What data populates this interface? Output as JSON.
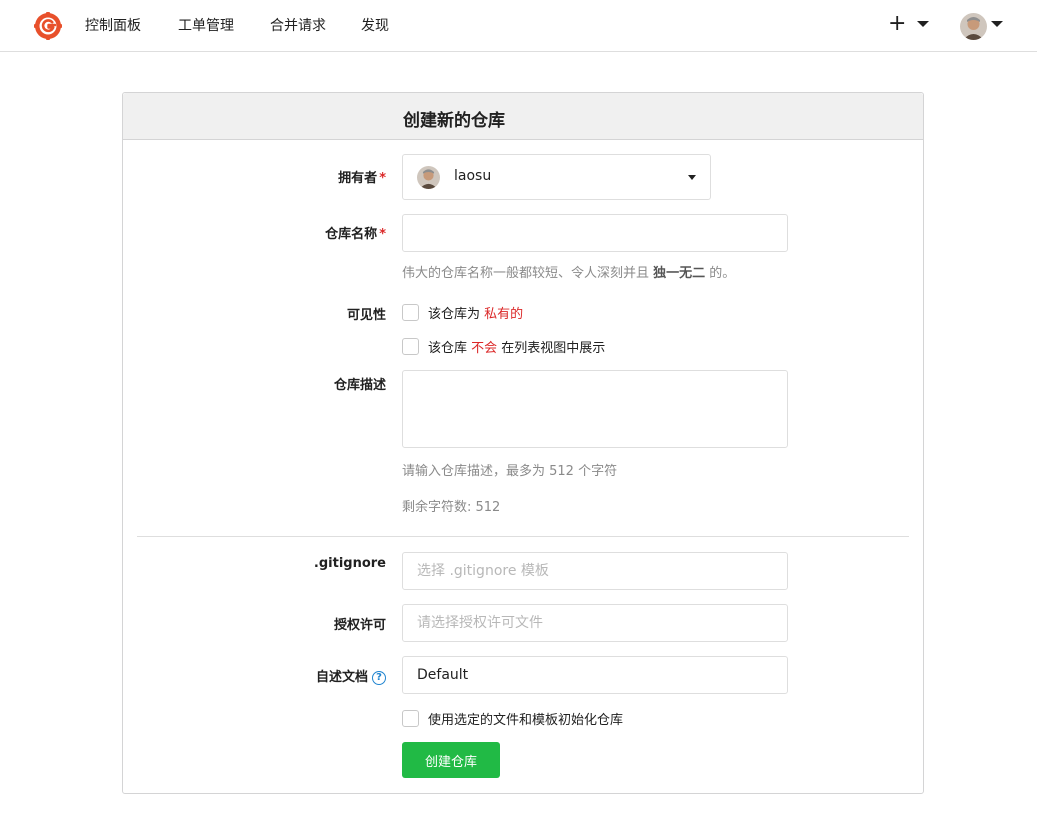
{
  "nav": {
    "items": [
      {
        "label": "控制面板"
      },
      {
        "label": "工单管理"
      },
      {
        "label": "合并请求"
      },
      {
        "label": "发现"
      }
    ],
    "plus": "+"
  },
  "form": {
    "title": "创建新的仓库",
    "owner": {
      "label": "拥有者",
      "required": "*",
      "value": "laosu"
    },
    "repo_name": {
      "label": "仓库名称",
      "required": "*",
      "value": "",
      "help_prefix": "伟大的仓库名称一般都较短、令人深刻并且 ",
      "help_bold": "独一无二",
      "help_suffix": " 的。"
    },
    "visibility": {
      "label": "可见性",
      "private_prefix": "该仓库为 ",
      "private_emph": "私有的",
      "template_prefix": "该仓库 ",
      "template_emph": "不会",
      "template_suffix": " 在列表视图中展示"
    },
    "description": {
      "label": "仓库描述",
      "help": "请输入仓库描述，最多为 512 个字符",
      "remaining": "剩余字符数: 512"
    },
    "gitignore": {
      "label": ".gitignore",
      "placeholder": "选择 .gitignore 模板"
    },
    "license": {
      "label": "授权许可",
      "placeholder": "请选择授权许可文件"
    },
    "readme": {
      "label": "自述文档",
      "value": "Default"
    },
    "init_label": "使用选定的文件和模板初始化仓库",
    "submit_label": "创建仓库"
  },
  "colors": {
    "accent_green": "#21ba45",
    "required_red": "#db2828",
    "logo_orange": "#e8502b"
  }
}
